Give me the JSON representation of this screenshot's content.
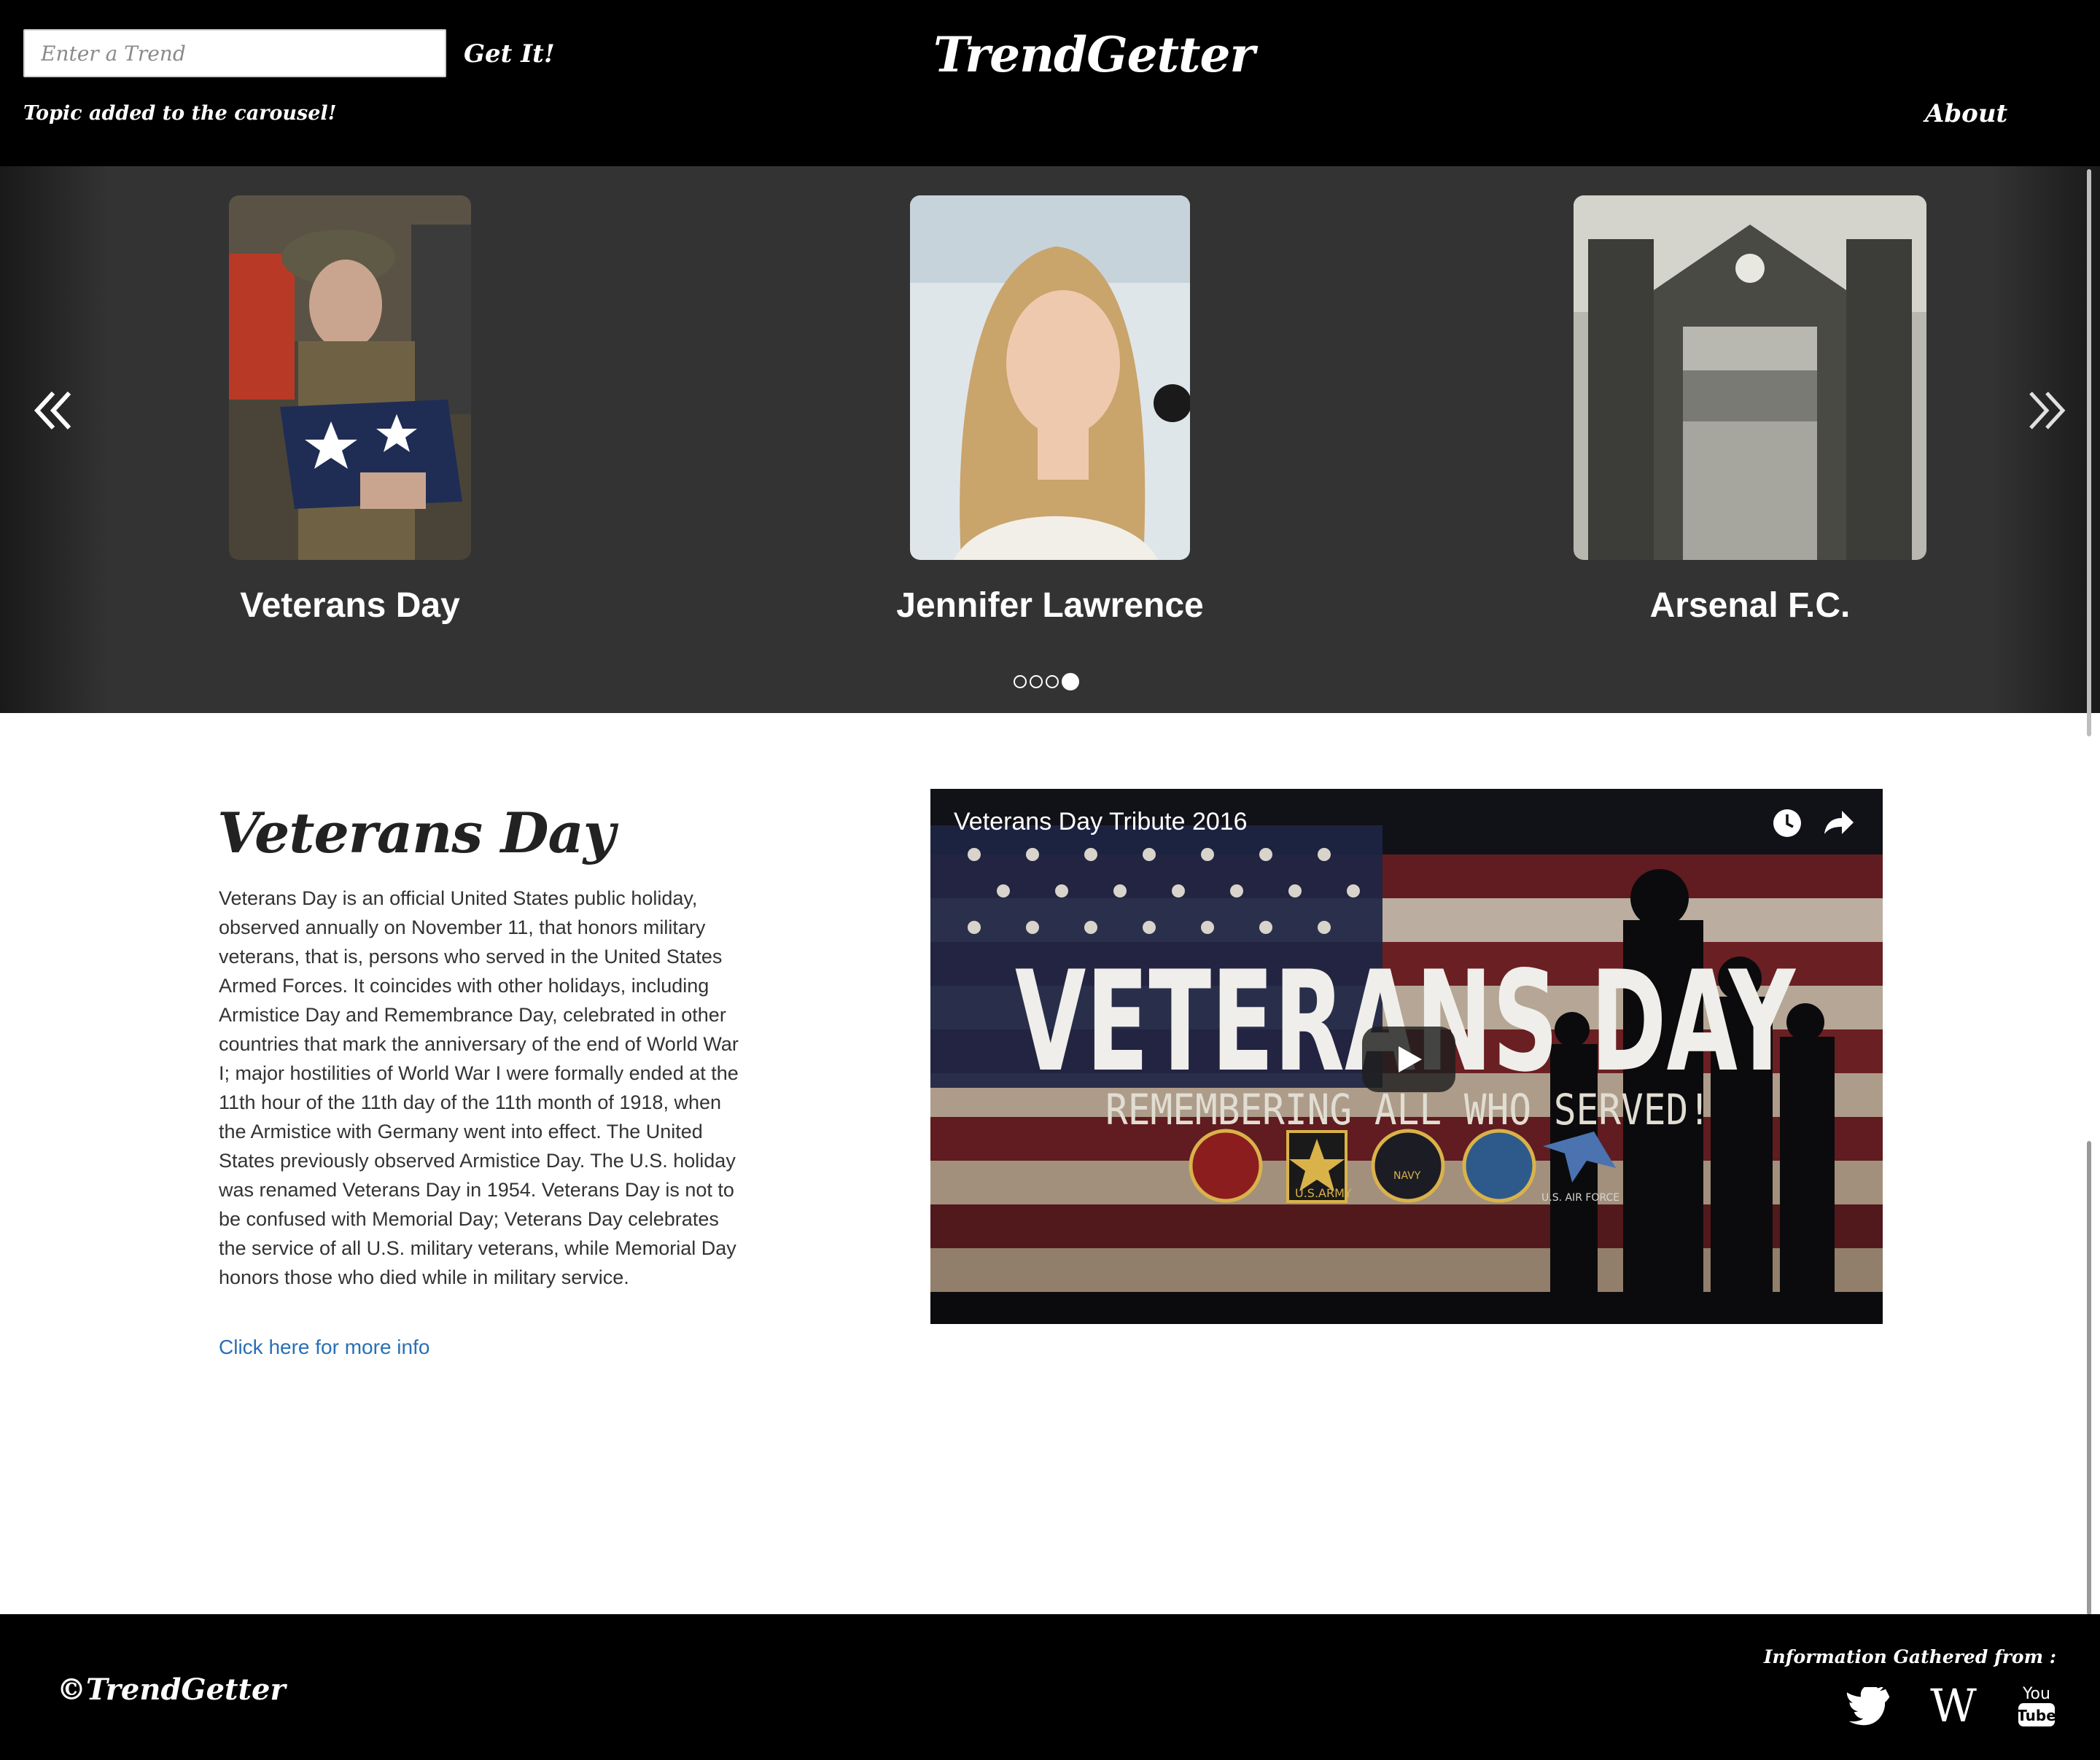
{
  "header": {
    "search_placeholder": "Enter a Trend",
    "get_label": "Get It!",
    "status_message": "Topic added to the carousel!",
    "brand": "TrendGetter",
    "about_label": "About"
  },
  "carousel": {
    "slides": [
      {
        "caption": "Veterans Day"
      },
      {
        "caption": "Jennifer Lawrence"
      },
      {
        "caption": "Arsenal F.C."
      }
    ],
    "indicator_count": 4,
    "active_indicator": 4
  },
  "topic": {
    "title": "Veterans Day",
    "description": "Veterans Day is an official United States public holiday, observed annually on November 11, that honors military veterans, that is, persons who served in the United States Armed Forces. It coincides with other holidays, including Armistice Day and Remembrance Day, celebrated in other countries that mark the anniversary of the end of World War I; major hostilities of World War I were formally ended at the 11th hour of the 11th day of the 11th month of 1918, when the Armistice with Germany went into effect. The United States previously observed Armistice Day. The U.S. holiday was renamed Veterans Day in 1954. Veterans Day is not to be confused with Memorial Day; Veterans Day celebrates the service of all U.S. military veterans, while Memorial Day honors those who died while in military service.",
    "more_info_label": "Click here for more info"
  },
  "video": {
    "title": "Veterans Day Tribute 2016",
    "thumbnail_headline": "VETERANS DAY",
    "thumbnail_subline": "REMEMBERING ALL WHO SERVED!",
    "thumbnail_army_label": "U.S.ARMY",
    "thumbnail_navy_label": "NAVY",
    "thumbnail_airforce_label": "U.S. AIR FORCE"
  },
  "footer": {
    "brand": "©TrendGetter",
    "sources_label": "Information Gathered from :",
    "wikipedia_glyph": "W",
    "youtube_you": "You",
    "youtube_tube": "Tube"
  },
  "icons": {
    "prev": "double-chevron-left-icon",
    "next": "double-chevron-right-icon",
    "watch_later": "clock-icon",
    "share": "share-arrow-icon",
    "play": "play-icon",
    "twitter": "twitter-bird-icon",
    "wikipedia": "wikipedia-w-icon",
    "youtube": "youtube-icon"
  },
  "colors": {
    "header_bg": "#000000",
    "carousel_bg": "#333333",
    "link": "#2a6fb5",
    "text": "#333333"
  }
}
